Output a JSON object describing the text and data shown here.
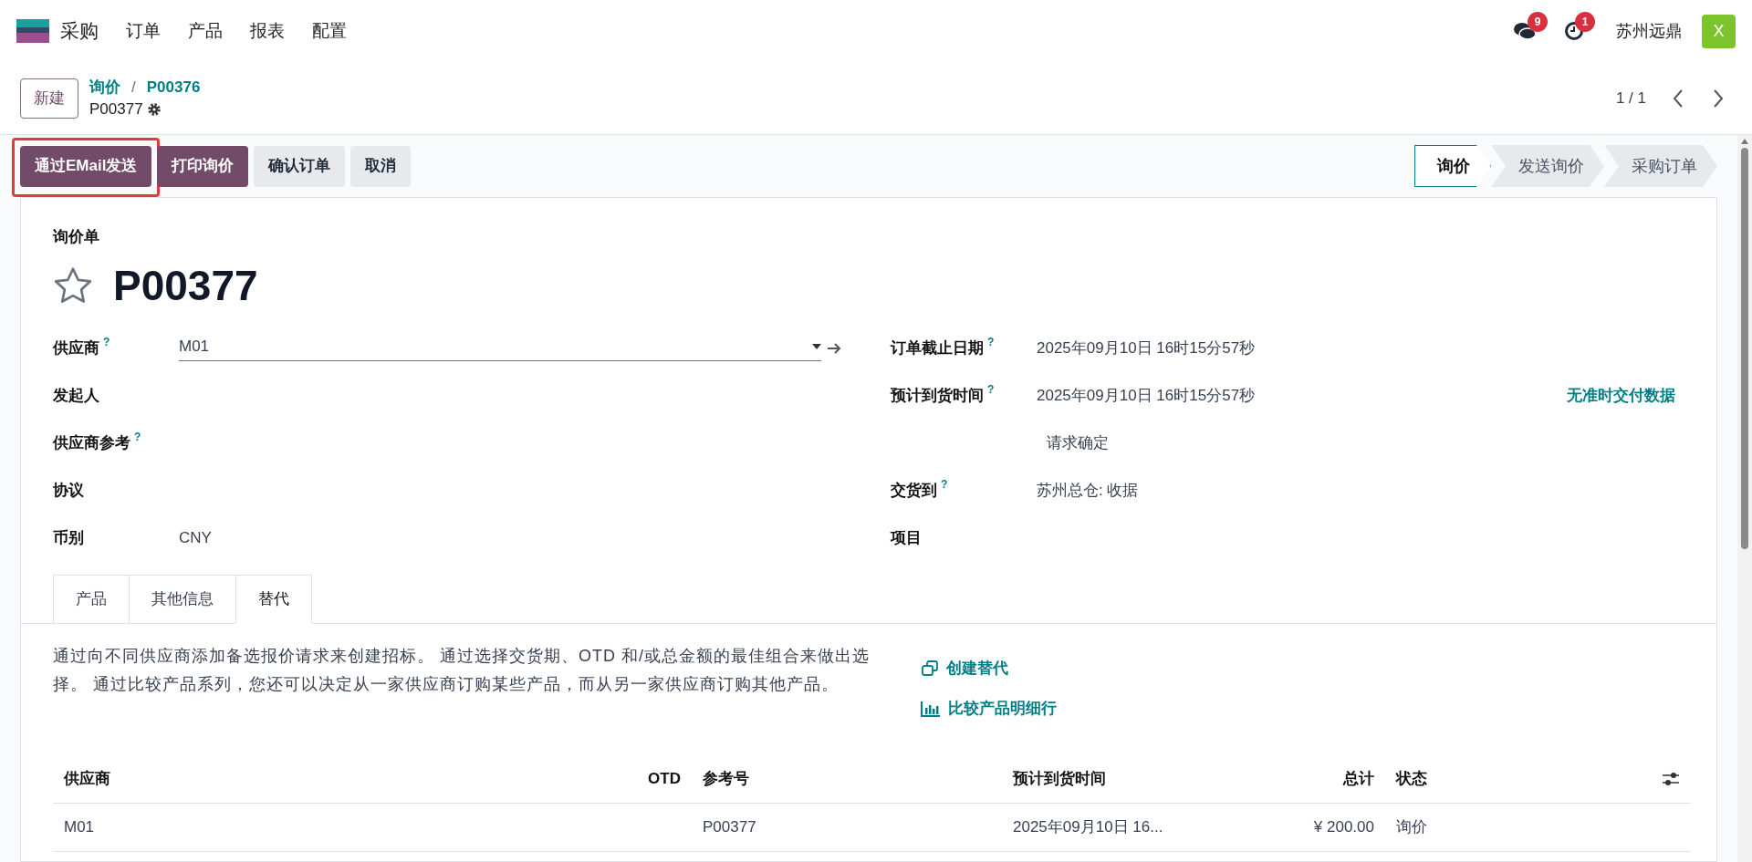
{
  "navbar": {
    "app": "采购",
    "menus": [
      "订单",
      "产品",
      "报表",
      "配置"
    ],
    "messages_count": "9",
    "activities_count": "1",
    "company": "苏州远鼎",
    "avatar": "X"
  },
  "control_panel": {
    "new_button": "新建",
    "breadcrumb": "询价",
    "separator": "/",
    "breadcrumb_link": "P00376",
    "record": "P00377",
    "pager": "1 / 1"
  },
  "actions": [
    {
      "label": "通过EMail发送",
      "primary": true,
      "highlighted": true
    },
    {
      "label": "打印询价",
      "primary": true,
      "highlighted": false
    },
    {
      "label": "确认订单",
      "primary": false,
      "highlighted": false
    },
    {
      "label": "取消",
      "primary": false,
      "highlighted": false
    }
  ],
  "status_steps": [
    {
      "label": "询价",
      "selected": true
    },
    {
      "label": "发送询价",
      "selected": false
    },
    {
      "label": "采购订单",
      "selected": false
    }
  ],
  "form": {
    "subtitle": "询价单",
    "title": "P00377",
    "starred": false,
    "left_fields": [
      {
        "label": "供应商",
        "help": "?",
        "kind": "select",
        "value": "M01"
      },
      {
        "label": "发起人",
        "kind": "text"
      },
      {
        "label": "供应商参考",
        "help": "?",
        "kind": "text"
      },
      {
        "label": "协议",
        "kind": "text"
      },
      {
        "label": "币别",
        "kind": "text",
        "value": "CNY"
      }
    ],
    "right_fields": [
      {
        "label": "订单截止日期",
        "help": "?",
        "value": "2025年09月10日 16时15分57秒"
      },
      {
        "label": "预计到货时间",
        "help": "?",
        "value": "2025年09月10日 16时15分57秒",
        "link": "无准时交付数据"
      },
      {
        "sub": "请求确定"
      },
      {
        "label": "交货到",
        "help": "?",
        "value": "苏州总仓: 收据"
      },
      {
        "label": "项目"
      }
    ]
  },
  "tabs": [
    {
      "label": "产品",
      "selected": false
    },
    {
      "label": "其他信息",
      "selected": false
    },
    {
      "label": "替代",
      "selected": true
    }
  ],
  "alternatives": {
    "description": "通过向不同供应商添加备选报价请求来创建招标。 通过选择交货期、OTD 和/或总金额的最佳组合来做出选择。 通过比较产品系列，您还可以决定从一家供应商订购某些产品，而从另一家供应商订购其他产品。",
    "links": [
      {
        "kind": "copy",
        "label": "创建替代"
      },
      {
        "kind": "chart",
        "label": "比较产品明细行"
      }
    ],
    "table": {
      "columns": [
        "供应商",
        "OTD",
        "参考号",
        "预计到货时间",
        "总计",
        "状态"
      ],
      "rows": [
        [
          "M01",
          "",
          "P00377",
          "2025年09月10日 16...",
          "¥ 200.00",
          "询价"
        ]
      ]
    }
  }
}
